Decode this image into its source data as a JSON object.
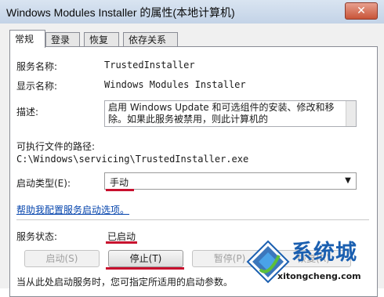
{
  "window": {
    "title": "Windows Modules Installer 的属性(本地计算机)",
    "close_glyph": "✕"
  },
  "tabs": [
    {
      "label": "常规",
      "active": true
    },
    {
      "label": "登录",
      "active": false
    },
    {
      "label": "恢复",
      "active": false
    },
    {
      "label": "依存关系",
      "active": false
    }
  ],
  "general": {
    "service_name_label": "服务名称:",
    "service_name": "TrustedInstaller",
    "display_name_label": "显示名称:",
    "display_name": "Windows Modules Installer",
    "description_label": "描述:",
    "description": "启用 Windows Update 和可选组件的安装、修改和移除。如果此服务被禁用，则此计算机的",
    "exe_path_label": "可执行文件的路径:",
    "exe_path": "C:\\Windows\\servicing\\TrustedInstaller.exe",
    "startup_type_label": "启动类型(E):",
    "startup_type_value": "手动",
    "help_link": "帮助我配置服务启动选项。",
    "service_status_label": "服务状态:",
    "service_status_value": "已启动",
    "buttons": {
      "start": "启动(S)",
      "stop": "停止(T)",
      "pause": "暂停(P)",
      "resume": "恢复(R)"
    },
    "bottom_note": "当从此处启动服务时，您可指定所适用的启动参数。"
  },
  "watermark": {
    "title": "系统城",
    "url": "xitongcheng.com"
  },
  "colors": {
    "annotation_underline": "#c8102e",
    "watermark_blue": "#1a5fb0"
  }
}
